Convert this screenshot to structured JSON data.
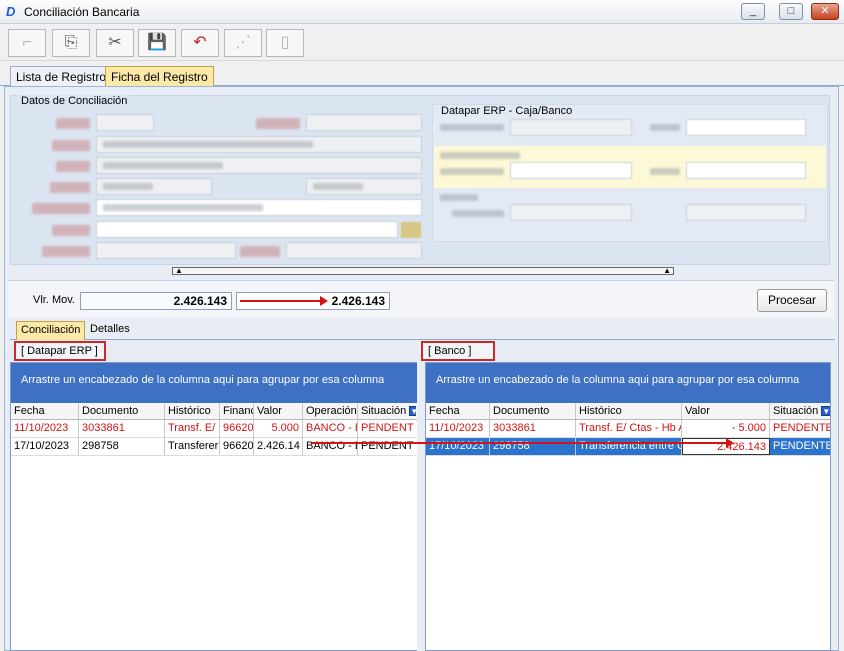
{
  "window": {
    "title": "Conciliación Bancaria",
    "app_icon": "app-logo-icon"
  },
  "window_controls": [
    "_",
    "□",
    "✕"
  ],
  "main_tabs": [
    {
      "label": "Lista de Registros",
      "active": false
    },
    {
      "label": "Ficha del Registro",
      "active": true
    }
  ],
  "datos": {
    "legend": "Datos de Conciliación"
  },
  "erp_group": {
    "legend": "Datapar ERP - Caja/Banco"
  },
  "vlr_mov": {
    "label": "Vlr. Mov.",
    "value": "2.426.143",
    "value2": "2.426.143"
  },
  "procesar_label": "Procesar",
  "sub_tabs": [
    {
      "label": "Conciliación",
      "active": true
    },
    {
      "label": "Detalles",
      "active": false
    }
  ],
  "left_grid": {
    "box_label": "[ Datapar ERP ]",
    "group_text": "Arrastre un encabezado de la columna aqui para agrupar por esa columna",
    "columns": [
      "Fecha",
      "Documento",
      "Histórico",
      "Financ",
      "Valor",
      "Operación",
      "Situación"
    ],
    "rows": [
      {
        "fecha": "11/10/2023",
        "documento": "3033861",
        "historico": "Transf. E/",
        "financ": "96620",
        "valor": "5.000",
        "operacion": "BANCO - E",
        "situacion": "PENDENT",
        "style": "red"
      },
      {
        "fecha": "17/10/2023",
        "documento": "298758",
        "historico": "Transferer",
        "financ": "96620:",
        "valor": "2.426.14",
        "operacion": "BANCO - E",
        "situacion": "PENDENT",
        "style": "normal"
      }
    ]
  },
  "right_grid": {
    "box_label": "[ Banco ]",
    "group_text": "Arrastre un encabezado de la columna aqui para agrupar por esa columna",
    "columns": [
      "Fecha",
      "Documento",
      "Histórico",
      "Valor",
      "Situación"
    ],
    "rows": [
      {
        "fecha": "11/10/2023",
        "documento": "3033861",
        "historico": "Transf. E/ Ctas - Hb A",
        "valor": "- 5.000",
        "situacion": "PENDENTE",
        "style": "red"
      },
      {
        "fecha": "17/10/2023",
        "documento": "298758",
        "historico": "Transferencia entre C",
        "valor": "2.426.143",
        "situacion": "PENDENTE",
        "style": "selected"
      }
    ]
  },
  "colors": {
    "accent": "#3e71c4",
    "highlight": "#fbe9a8",
    "error_text": "#d21414",
    "selection": "#2b73cc"
  }
}
